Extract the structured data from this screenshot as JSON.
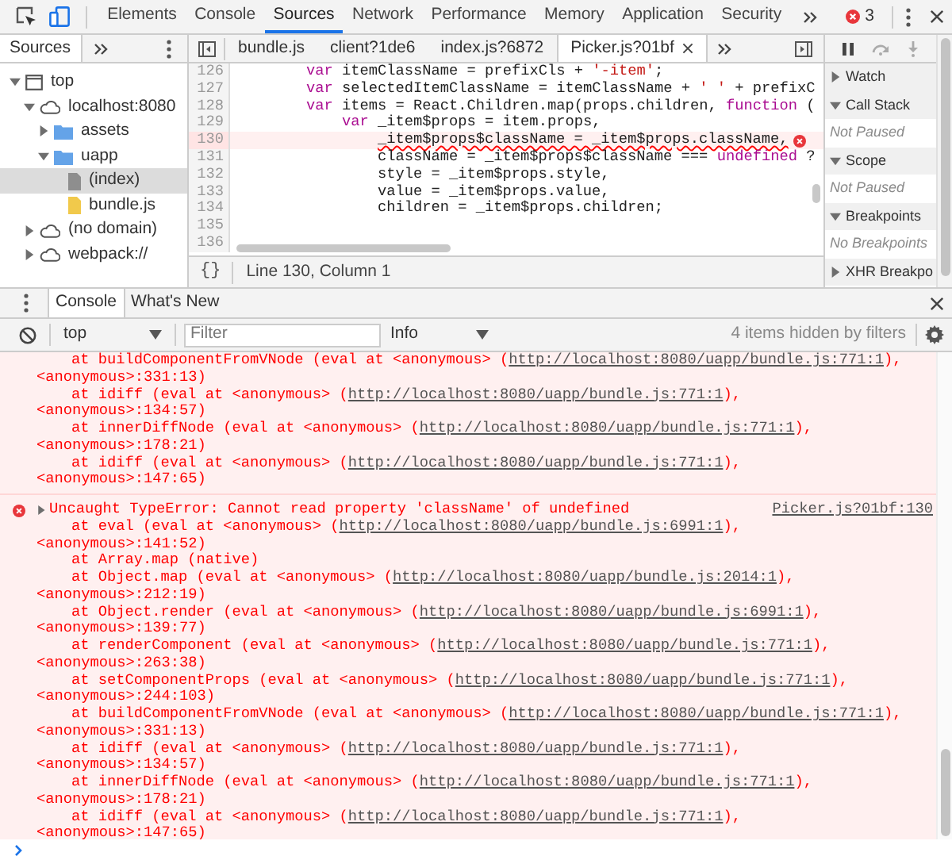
{
  "toolbar": {
    "tabs": [
      {
        "label": "Elements",
        "selected": false
      },
      {
        "label": "Console",
        "selected": false
      },
      {
        "label": "Sources",
        "selected": true
      },
      {
        "label": "Network",
        "selected": false
      },
      {
        "label": "Performance",
        "selected": false
      },
      {
        "label": "Memory",
        "selected": false
      },
      {
        "label": "Application",
        "selected": false
      },
      {
        "label": "Security",
        "selected": false
      }
    ],
    "error_count": "3"
  },
  "navigator": {
    "tabs": [
      {
        "label": "Sources",
        "selected": true
      }
    ],
    "tree": [
      {
        "label": "top",
        "kind": "frame",
        "expanded": true,
        "selected": false,
        "children": [
          {
            "label": "localhost:8080",
            "kind": "domain",
            "expanded": true,
            "selected": false,
            "children": [
              {
                "label": "assets",
                "kind": "folder",
                "expanded": false,
                "selected": false
              },
              {
                "label": "uapp",
                "kind": "folder",
                "expanded": true,
                "selected": false,
                "children": [
                  {
                    "label": "(index)",
                    "kind": "document",
                    "selected": true
                  },
                  {
                    "label": "bundle.js",
                    "kind": "script",
                    "selected": false
                  }
                ]
              }
            ]
          },
          {
            "label": "(no domain)",
            "kind": "domain",
            "expanded": false,
            "selected": false
          },
          {
            "label": "webpack://",
            "kind": "domain",
            "expanded": false,
            "selected": false
          }
        ]
      }
    ]
  },
  "editor": {
    "tabs": [
      {
        "label": "bundle.js",
        "selected": false,
        "closable": false
      },
      {
        "label": "client?1de6",
        "selected": false,
        "closable": false
      },
      {
        "label": "index.js?6872",
        "selected": false,
        "closable": false
      },
      {
        "label": "Picker.js?01bf",
        "selected": true,
        "closable": true
      }
    ],
    "lines": [
      {
        "number": "126",
        "error": false,
        "tokens": [
          {
            "kind": "keyword",
            "text": "        var"
          },
          {
            "kind": "plain",
            "text": " itemClassName = prefixCls + "
          },
          {
            "kind": "string",
            "text": "'-item'"
          },
          {
            "kind": "plain",
            "text": ";"
          }
        ]
      },
      {
        "number": "127",
        "error": false,
        "tokens": [
          {
            "kind": "keyword",
            "text": "        var"
          },
          {
            "kind": "plain",
            "text": " selectedItemClassName = itemClassName + "
          },
          {
            "kind": "string",
            "text": "' '"
          },
          {
            "kind": "plain",
            "text": " + prefixC"
          }
        ]
      },
      {
        "number": "128",
        "error": false,
        "tokens": [
          {
            "kind": "keyword",
            "text": "        var"
          },
          {
            "kind": "plain",
            "text": " items = React.Children.map(props.children, "
          },
          {
            "kind": "keyword",
            "text": "function"
          },
          {
            "kind": "plain",
            "text": " ("
          }
        ]
      },
      {
        "number": "129",
        "error": false,
        "tokens": [
          {
            "kind": "keyword",
            "text": "            var"
          },
          {
            "kind": "plain",
            "text": " _item$props = item.props,"
          }
        ]
      },
      {
        "number": "130",
        "error": true,
        "tokens": [
          {
            "kind": "plain",
            "text": "                _item$props$className = _item$props.className,"
          }
        ]
      },
      {
        "number": "131",
        "error": false,
        "tokens": [
          {
            "kind": "plain",
            "text": "                className = _item$props$className === "
          },
          {
            "kind": "keyword",
            "text": "undefined"
          },
          {
            "kind": "plain",
            "text": " ?"
          }
        ]
      },
      {
        "number": "132",
        "error": false,
        "tokens": [
          {
            "kind": "plain",
            "text": "                style = _item$props.style,"
          }
        ]
      },
      {
        "number": "133",
        "error": false,
        "tokens": [
          {
            "kind": "plain",
            "text": "                value = _item$props.value,"
          }
        ]
      },
      {
        "number": "134",
        "error": false,
        "tokens": [
          {
            "kind": "plain",
            "text": "                children = _item$props.children;"
          }
        ]
      },
      {
        "number": "135",
        "error": false
      },
      {
        "number": "136",
        "error": false
      }
    ],
    "format_button": "{}",
    "status": "Line 130, Column 1"
  },
  "debugger": {
    "sections": [
      {
        "title": "Watch",
        "expanded": false
      },
      {
        "title": "Call Stack",
        "expanded": true,
        "empty_text": "Not Paused"
      },
      {
        "title": "Scope",
        "expanded": true,
        "empty_text": "Not Paused"
      },
      {
        "title": "Breakpoints",
        "expanded": true,
        "empty_text": "No Breakpoints"
      },
      {
        "title": "XHR Breakpo",
        "expanded": false
      }
    ]
  },
  "drawer": {
    "tabs": [
      {
        "label": "Console",
        "selected": true
      },
      {
        "label": "What's New",
        "selected": false
      }
    ],
    "context": "top",
    "filter_placeholder": "Filter",
    "log_level_filter": "Info",
    "hidden_note": "4 items hidden by filters",
    "messages": [
      {
        "frames": [
          {
            "call": "at buildComponentFromVNode (eval at <anonymous> (",
            "url": "http://localhost:8080/uapp/bundle.js:771:1",
            "end": "),",
            "location": "<anonymous>:331:13)"
          },
          {
            "call": "at idiff (eval at <anonymous> (",
            "url": "http://localhost:8080/uapp/bundle.js:771:1",
            "end": "),",
            "location": "<anonymous>:134:57)"
          },
          {
            "call": "at innerDiffNode (eval at <anonymous> (",
            "url": "http://localhost:8080/uapp/bundle.js:771:1",
            "end": "),",
            "location": "<anonymous>:178:21)"
          },
          {
            "call": "at idiff (eval at <anonymous> (",
            "url": "http://localhost:8080/uapp/bundle.js:771:1",
            "end": "),",
            "location": "<anonymous>:147:65)"
          }
        ]
      },
      {
        "text": "Uncaught TypeError: Cannot read property 'className' of undefined",
        "expanded": false,
        "source": "Picker.js?01bf:130",
        "frames": [
          {
            "call": "at eval (eval at <anonymous> (",
            "url": "http://localhost:8080/uapp/bundle.js:6991:1",
            "end": "),",
            "location": "<anonymous>:141:52)"
          },
          {
            "call": "at Array.map (native)"
          },
          {
            "call": "at Object.map (eval at <anonymous> (",
            "url": "http://localhost:8080/uapp/bundle.js:2014:1",
            "end": "),",
            "location": "<anonymous>:212:19)"
          },
          {
            "call": "at Object.render (eval at <anonymous> (",
            "url": "http://localhost:8080/uapp/bundle.js:6991:1",
            "end": "),",
            "location": "<anonymous>:139:77)"
          },
          {
            "call": "at renderComponent (eval at <anonymous> (",
            "url": "http://localhost:8080/uapp/bundle.js:771:1",
            "end": "),",
            "location": "<anonymous>:263:38)"
          },
          {
            "call": "at setComponentProps (eval at <anonymous> (",
            "url": "http://localhost:8080/uapp/bundle.js:771:1",
            "end": "),",
            "location": "<anonymous>:244:103)"
          },
          {
            "call": "at buildComponentFromVNode (eval at <anonymous> (",
            "url": "http://localhost:8080/uapp/bundle.js:771:1",
            "end": "),",
            "location": "<anonymous>:331:13)"
          },
          {
            "call": "at idiff (eval at <anonymous> (",
            "url": "http://localhost:8080/uapp/bundle.js:771:1",
            "end": "),",
            "location": "<anonymous>:134:57)"
          },
          {
            "call": "at innerDiffNode (eval at <anonymous> (",
            "url": "http://localhost:8080/uapp/bundle.js:771:1",
            "end": "),",
            "location": "<anonymous>:178:21)"
          },
          {
            "call": "at idiff (eval at <anonymous> (",
            "url": "http://localhost:8080/uapp/bundle.js:771:1",
            "end": "),",
            "location": "<anonymous>:147:65)"
          }
        ]
      }
    ]
  }
}
